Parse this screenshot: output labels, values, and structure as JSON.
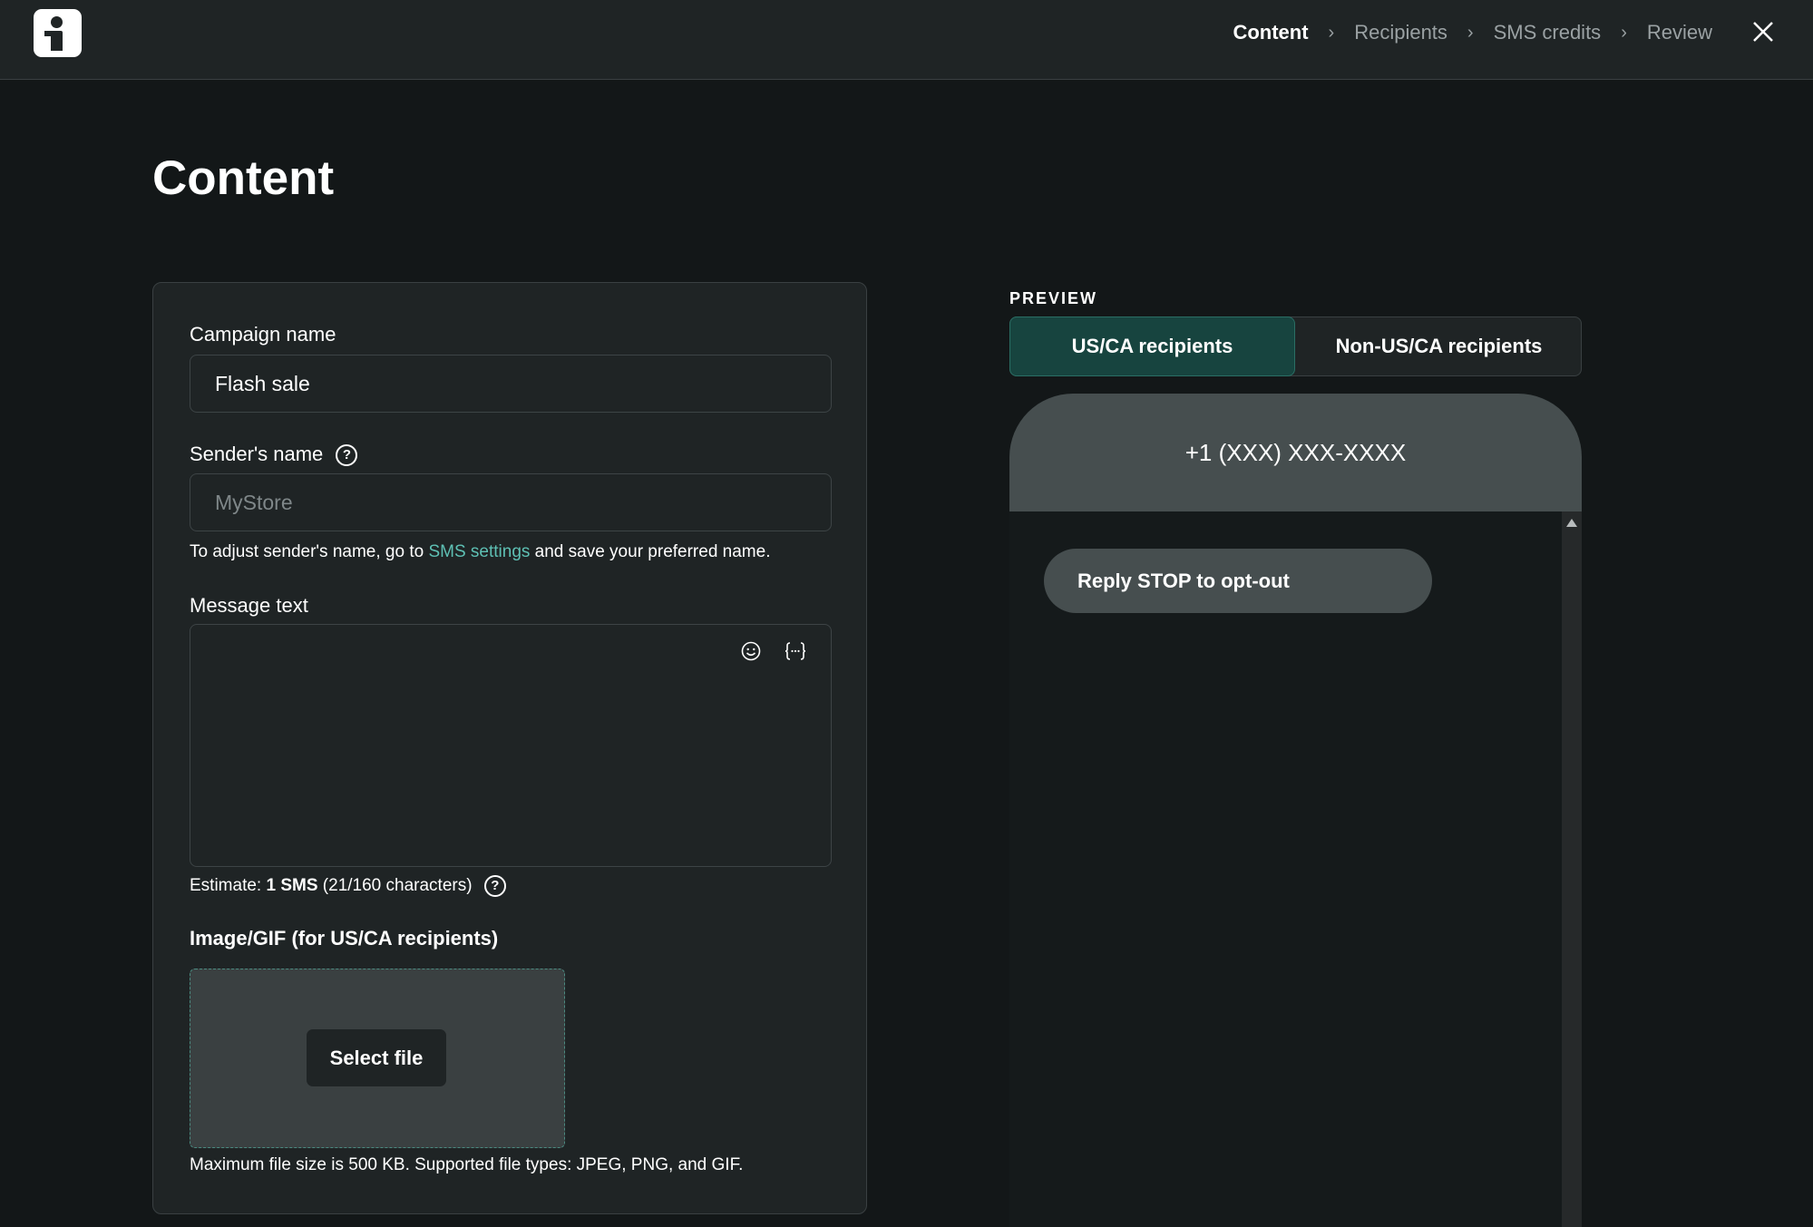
{
  "steps": [
    {
      "label": "Content",
      "active": true
    },
    {
      "label": "Recipients",
      "active": false
    },
    {
      "label": "SMS credits",
      "active": false
    },
    {
      "label": "Review",
      "active": false
    }
  ],
  "page_title": "Content",
  "form": {
    "campaign_name_label": "Campaign name",
    "campaign_name_value": "Flash sale",
    "sender_name_label": "Sender's name",
    "sender_name_placeholder": "MyStore",
    "sender_hint_prefix": "To adjust sender's name, go to ",
    "sender_hint_link": "SMS settings",
    "sender_hint_suffix": " and save your preferred name.",
    "message_text_label": "Message text",
    "message_text_value": "",
    "estimate_prefix": "Estimate: ",
    "estimate_bold": "1 SMS",
    "estimate_suffix": " (21/160 characters)",
    "image_label": "Image/GIF (for US/CA recipients)",
    "select_file_label": "Select file",
    "file_hint": "Maximum file size is 500 KB. Supported file types: JPEG, PNG, and GIF."
  },
  "preview": {
    "label": "PREVIEW",
    "tabs": [
      {
        "label": "US/CA recipients",
        "active": true
      },
      {
        "label": "Non-US/CA recipients",
        "active": false
      }
    ],
    "phone_number": "+1 (XXX) XXX-XXXX",
    "bubble_text": "Reply STOP to opt-out"
  },
  "icons": {
    "logo": "brand-logo",
    "close": "close-icon",
    "help": "help-circle-icon",
    "emoji": "emoji-icon",
    "variable": "variable-braces-icon",
    "chevron": "chevron-right-icon"
  },
  "colors": {
    "accent_link": "#5ec0b4",
    "active_tab": "#17443f",
    "topbar": "#1f2425",
    "background": "#131718"
  }
}
